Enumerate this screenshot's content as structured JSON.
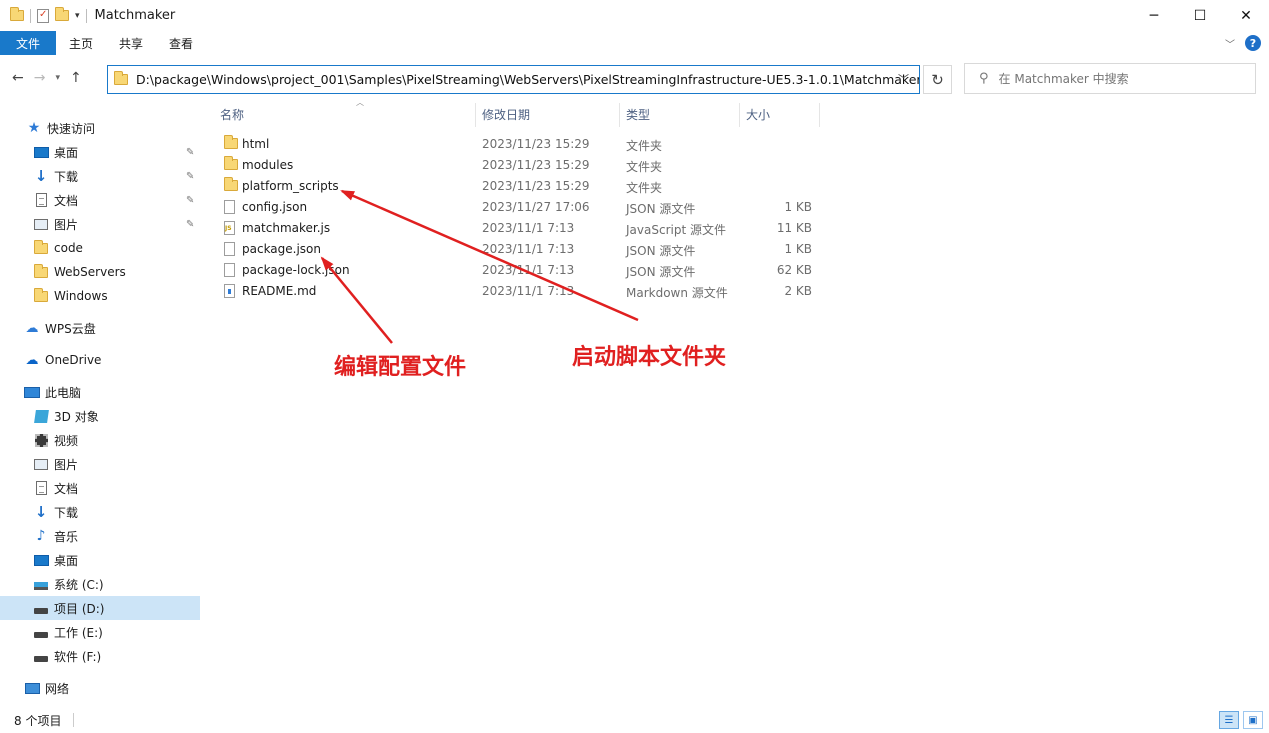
{
  "window": {
    "title": "Matchmaker",
    "minimize": "─",
    "maximize": "☐",
    "close": "✕"
  },
  "ribbon": {
    "tabs": [
      "文件",
      "主页",
      "共享",
      "查看"
    ],
    "help": "?"
  },
  "address": {
    "path": "D:\\package\\Windows\\project_001\\Samples\\PixelStreaming\\WebServers\\PixelStreamingInfrastructure-UE5.3-1.0.1\\Matchmaker",
    "search_placeholder": "在 Matchmaker 中搜索"
  },
  "sidebar": {
    "quick_access": "快速访问",
    "items": [
      {
        "label": "快速访问",
        "icon": "star-icon"
      },
      {
        "label": "桌面",
        "icon": "desktop-icon",
        "pinned": true
      },
      {
        "label": "下载",
        "icon": "download-icon",
        "pinned": true
      },
      {
        "label": "文档",
        "icon": "document-icon",
        "pinned": true
      },
      {
        "label": "图片",
        "icon": "pictures-icon",
        "pinned": true
      },
      {
        "label": "code",
        "icon": "folder-icon"
      },
      {
        "label": "WebServers",
        "icon": "folder-icon"
      },
      {
        "label": "Windows",
        "icon": "folder-icon"
      },
      {
        "label": "WPS云盘",
        "icon": "wps-cloud-icon"
      },
      {
        "label": "OneDrive",
        "icon": "onedrive-icon"
      },
      {
        "label": "此电脑",
        "icon": "this-pc-icon"
      },
      {
        "label": "3D 对象",
        "icon": "3d-objects-icon"
      },
      {
        "label": "视频",
        "icon": "videos-icon"
      },
      {
        "label": "图片",
        "icon": "pictures-icon"
      },
      {
        "label": "文档",
        "icon": "document-icon"
      },
      {
        "label": "下载",
        "icon": "download-icon"
      },
      {
        "label": "音乐",
        "icon": "music-icon"
      },
      {
        "label": "桌面",
        "icon": "desktop-icon"
      },
      {
        "label": "系统 (C:)",
        "icon": "system-drive-icon"
      },
      {
        "label": "项目 (D:)",
        "icon": "drive-icon",
        "selected": true
      },
      {
        "label": "工作 (E:)",
        "icon": "drive-icon"
      },
      {
        "label": "软件 (F:)",
        "icon": "drive-icon"
      },
      {
        "label": "网络",
        "icon": "network-icon"
      }
    ]
  },
  "columns": {
    "name": "名称",
    "date": "修改日期",
    "type": "类型",
    "size": "大小"
  },
  "files": [
    {
      "name": "html",
      "date": "2023/11/23 15:29",
      "type": "文件夹",
      "size": "",
      "icon": "folder-icon"
    },
    {
      "name": "modules",
      "date": "2023/11/23 15:29",
      "type": "文件夹",
      "size": "",
      "icon": "folder-icon"
    },
    {
      "name": "platform_scripts",
      "date": "2023/11/23 15:29",
      "type": "文件夹",
      "size": "",
      "icon": "folder-icon"
    },
    {
      "name": "config.json",
      "date": "2023/11/27 17:06",
      "type": "JSON 源文件",
      "size": "1 KB",
      "icon": "json-file-icon"
    },
    {
      "name": "matchmaker.js",
      "date": "2023/11/1 7:13",
      "type": "JavaScript 源文件",
      "size": "11 KB",
      "icon": "js-file-icon"
    },
    {
      "name": "package.json",
      "date": "2023/11/1 7:13",
      "type": "JSON 源文件",
      "size": "1 KB",
      "icon": "json-file-icon"
    },
    {
      "name": "package-lock.json",
      "date": "2023/11/1 7:13",
      "type": "JSON 源文件",
      "size": "62 KB",
      "icon": "json-file-icon"
    },
    {
      "name": "README.md",
      "date": "2023/11/1 7:13",
      "type": "Markdown 源文件",
      "size": "2 KB",
      "icon": "markdown-file-icon"
    }
  ],
  "annotations": {
    "edit_config": "编辑配置文件",
    "startup_scripts": "启动脚本文件夹",
    "color": "#e02020"
  },
  "status": {
    "item_count": "8 个项目"
  },
  "colors": {
    "accent": "#1979ca",
    "selected": "#cce4f7"
  }
}
